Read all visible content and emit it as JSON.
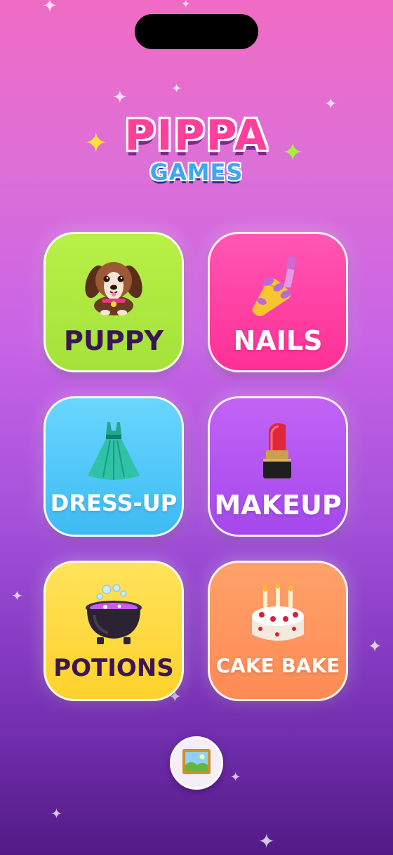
{
  "logo": {
    "title": "PIPPA",
    "subtitle": "GAMES"
  },
  "games": [
    {
      "label": "PUPPY",
      "icon": "puppy-icon",
      "color": "#a8e63c"
    },
    {
      "label": "NAILS",
      "icon": "nail-polish-icon",
      "color": "#ff3f9f"
    },
    {
      "label": "DRESS-UP",
      "icon": "dress-icon",
      "color": "#4cc4f8"
    },
    {
      "label": "MAKEUP",
      "icon": "lipstick-icon",
      "color": "#ad52ef"
    },
    {
      "label": "POTIONS",
      "icon": "cauldron-icon",
      "color": "#ffd633"
    },
    {
      "label": "CAKE BAKE",
      "icon": "cake-icon",
      "color": "#ff9460"
    }
  ],
  "gallery": {
    "icon": "framed-picture-icon"
  },
  "colors": {
    "background_top": "#f06cc4",
    "background_bottom": "#521b86",
    "label_dark": "#3b1554"
  }
}
